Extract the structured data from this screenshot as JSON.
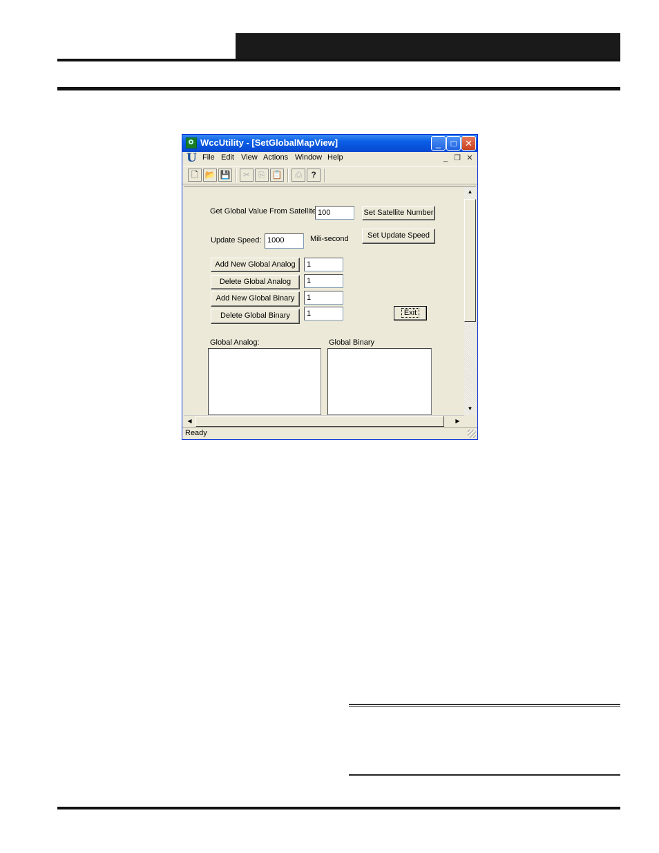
{
  "window": {
    "title": "WccUtility - [SetGlobalMapView]"
  },
  "titlebar_buttons": {
    "minimize": "_",
    "maximize": "□",
    "close": "✕"
  },
  "menu": {
    "logo": "U",
    "items": [
      "File",
      "Edit",
      "View",
      "Actions",
      "Window",
      "Help"
    ],
    "mdi": {
      "minimize": "_",
      "restore": "❐",
      "close": "✕"
    }
  },
  "toolbar": {
    "icons": [
      {
        "name": "new-icon",
        "glyph": "🗋"
      },
      {
        "name": "open-icon",
        "glyph": "📂"
      },
      {
        "name": "save-icon",
        "glyph": "💾"
      },
      {
        "name": "cut-icon",
        "glyph": "✂"
      },
      {
        "name": "copy-icon",
        "glyph": "⎘"
      },
      {
        "name": "paste-icon",
        "glyph": "📋"
      },
      {
        "name": "print-icon",
        "glyph": "⎙"
      },
      {
        "name": "help-icon",
        "glyph": "?"
      }
    ]
  },
  "form": {
    "satellite_label": "Get Global Value From Satellite:",
    "satellite_value": "100",
    "set_satellite_button": "Set Satellite Number",
    "update_speed_label": "Update Speed:",
    "update_speed_value": "1000",
    "update_speed_unit": "Mili-second",
    "set_update_speed_button": "Set Update Speed",
    "add_analog_button": "Add New Global Analog",
    "add_analog_value": "1",
    "delete_analog_button": "Delete Global Analog",
    "delete_analog_value": "1",
    "add_binary_button": "Add New Global Binary",
    "add_binary_value": "1",
    "delete_binary_button": "Delete Global Binary",
    "delete_binary_value": "1",
    "exit_button": "Exit",
    "global_analog_label": "Global Analog:",
    "global_binary_label": "Global Binary"
  },
  "scroll": {
    "up": "▲",
    "down": "▼",
    "left": "◀",
    "right": "▶"
  },
  "status": {
    "text": "Ready"
  },
  "colors": {
    "titlebar": "#0a5ee6",
    "window_bg": "#ece9d8",
    "close_button": "#c8401e"
  }
}
